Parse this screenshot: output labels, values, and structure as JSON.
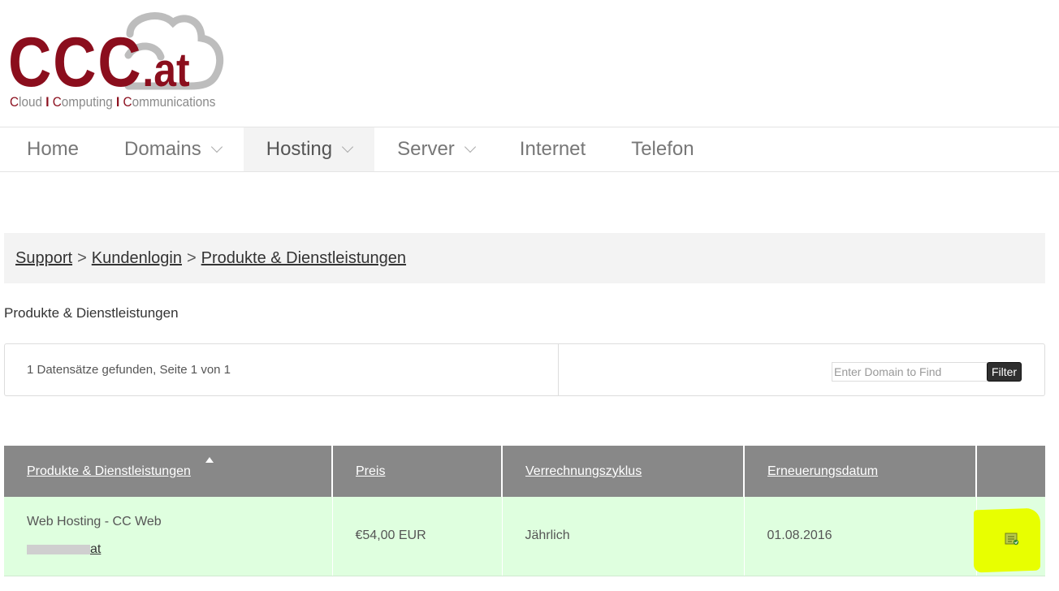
{
  "logo": {
    "main": "CCC",
    "suffix": ".at",
    "tagline_parts": [
      "C",
      "loud ",
      "I ",
      "C",
      "omputing ",
      "I ",
      "C",
      "ommunications"
    ],
    "colors": {
      "brand": "#8b0e1d",
      "gray": "#bdbdbd"
    }
  },
  "nav": {
    "items": [
      {
        "label": "Home",
        "has_dropdown": false
      },
      {
        "label": "Domains",
        "has_dropdown": true
      },
      {
        "label": "Hosting",
        "has_dropdown": true,
        "active": true
      },
      {
        "label": "Server",
        "has_dropdown": true
      },
      {
        "label": "Internet",
        "has_dropdown": false
      },
      {
        "label": "Telefon",
        "has_dropdown": false
      }
    ]
  },
  "breadcrumb": {
    "items": [
      "Support",
      "Kundenlogin",
      "Produkte & Dienstleistungen"
    ],
    "separator": ">"
  },
  "page": {
    "title": "Produkte & Dienstleistungen"
  },
  "records": {
    "summary": "1 Datensätze gefunden, Seite 1 von 1",
    "search_placeholder": "Enter Domain to Find",
    "filter_label": "Filter"
  },
  "table": {
    "headers": [
      "Produkte & Dienstleistungen",
      "Preis",
      "Verrechnungszyklus",
      "Erneuerungsdatum"
    ],
    "rows": [
      {
        "product": "Web Hosting - CC Web",
        "domain_suffix": "at",
        "price": "€54,00 EUR",
        "cycle": "Jährlich",
        "renewal": "01.08.2016",
        "action_icon": "details-icon"
      }
    ],
    "row_color": "#dfffdf",
    "header_color": "#888888",
    "highlight_color": "#e8ff00"
  }
}
